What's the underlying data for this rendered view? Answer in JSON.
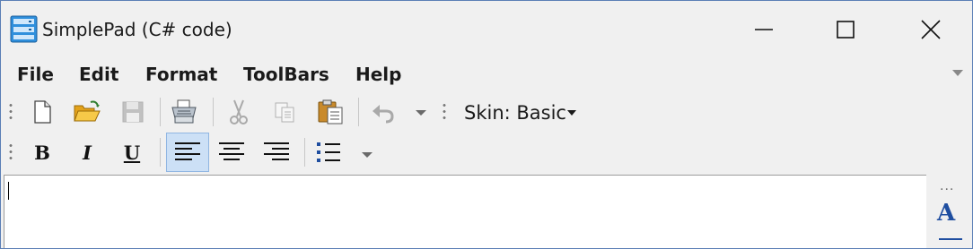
{
  "window": {
    "title": "SimplePad (C# code)",
    "icon": "notepad-app-icon",
    "controls": [
      "minimize-icon",
      "maximize-icon",
      "close-icon"
    ]
  },
  "menu": {
    "items": [
      "File",
      "Edit",
      "Format",
      "ToolBars",
      "Help"
    ],
    "overflow_icon": "chevron-down-icon"
  },
  "toolbar_standard": {
    "tools": [
      {
        "name": "new",
        "icon": "new-document-icon",
        "enabled": true
      },
      {
        "name": "open",
        "icon": "open-folder-icon",
        "enabled": true
      },
      {
        "name": "save",
        "icon": "save-disk-icon",
        "enabled": false
      },
      {
        "name": "print",
        "icon": "printer-icon",
        "enabled": true
      },
      {
        "name": "cut",
        "icon": "scissors-icon",
        "enabled": false
      },
      {
        "name": "copy",
        "icon": "copy-icon",
        "enabled": false
      },
      {
        "name": "paste",
        "icon": "paste-clipboard-icon",
        "enabled": true
      },
      {
        "name": "undo",
        "icon": "undo-icon",
        "enabled": false
      }
    ],
    "skin_label": "Skin: Basic"
  },
  "toolbar_format": {
    "bold": "B",
    "italic": "I",
    "underline": "U",
    "alignment_selected": "left",
    "alignments": [
      "left",
      "center",
      "right"
    ],
    "list_icon": "bullet-list-icon"
  },
  "editor": {
    "content": ""
  },
  "side_panel": {
    "more_label": "...",
    "font_label": "A"
  },
  "colors": {
    "accent": "#1f4ea0",
    "selection": "#cce0f6",
    "border": "#5b7fb6"
  }
}
